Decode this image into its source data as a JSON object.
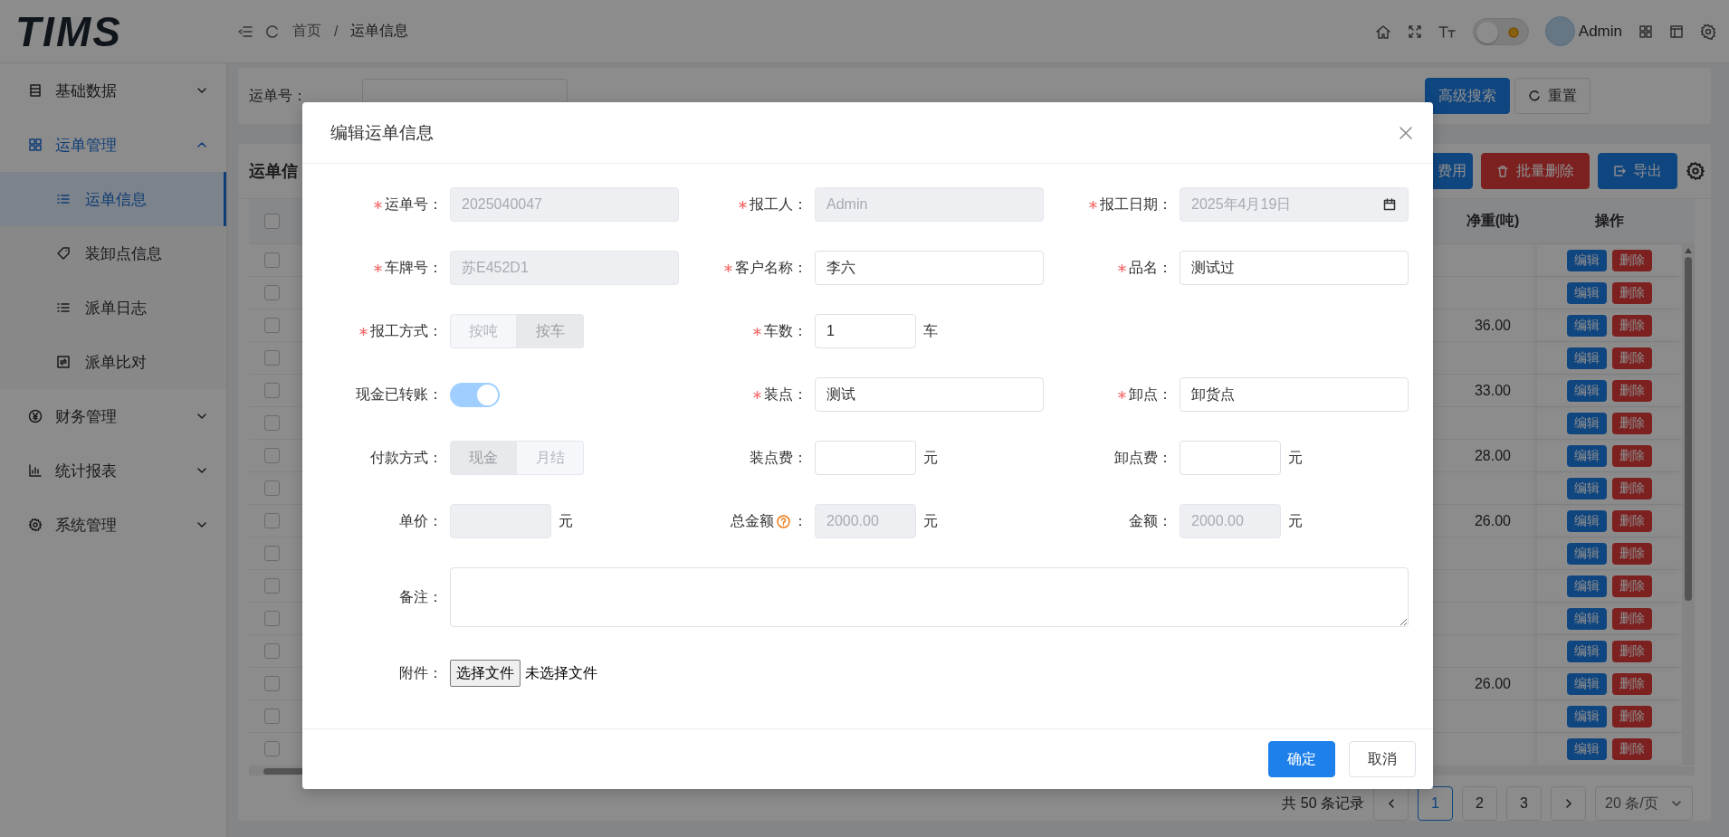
{
  "topbar": {
    "logo": "TIMS",
    "breadcrumb": [
      "首页",
      "运单信息"
    ],
    "separator": "/",
    "theme_switch": {
      "on": false
    },
    "user": "Admin"
  },
  "sidebar": {
    "items": [
      {
        "label": "基础数据",
        "expanded": false
      },
      {
        "label": "运单管理",
        "expanded": true,
        "children": [
          {
            "label": "运单信息",
            "selected": true
          },
          {
            "label": "装卸点信息",
            "selected": false
          },
          {
            "label": "派单日志",
            "selected": false
          },
          {
            "label": "派单比对",
            "selected": false
          }
        ]
      },
      {
        "label": "财务管理",
        "expanded": false
      },
      {
        "label": "统计报表",
        "expanded": false
      },
      {
        "label": "系统管理",
        "expanded": false
      }
    ]
  },
  "search_bar": {
    "label": "运单号：",
    "buttons": [
      {
        "label": "高级搜索",
        "kind": "primary"
      },
      {
        "label": "重置",
        "kind": "default"
      }
    ]
  },
  "table": {
    "title": "运单信",
    "toolbar_buttons": [
      {
        "label": "费用",
        "kind": "primary"
      },
      {
        "label": "批量删除",
        "kind": "danger"
      },
      {
        "label": "导出",
        "kind": "primary"
      }
    ],
    "select_all": false,
    "columns": [
      "净重(吨)",
      "操作"
    ],
    "rows": [
      {
        "selected": false,
        "actions": [
          "编辑",
          "删除"
        ]
      },
      {
        "selected": false,
        "actions": [
          "编辑",
          "删除"
        ]
      },
      {
        "selected": false,
        "net_weight": "36.00",
        "actions": [
          "编辑",
          "删除"
        ]
      },
      {
        "selected": false,
        "actions": [
          "编辑",
          "删除"
        ]
      },
      {
        "selected": false,
        "net_weight": "33.00",
        "actions": [
          "编辑",
          "删除"
        ]
      },
      {
        "selected": false,
        "actions": [
          "编辑",
          "删除"
        ]
      },
      {
        "selected": false,
        "net_weight": "28.00",
        "actions": [
          "编辑",
          "删除"
        ]
      },
      {
        "selected": false,
        "actions": [
          "编辑",
          "删除"
        ]
      },
      {
        "selected": false,
        "net_weight": "26.00",
        "actions": [
          "编辑",
          "删除"
        ]
      },
      {
        "selected": false,
        "actions": [
          "编辑",
          "删除"
        ]
      },
      {
        "selected": false,
        "actions": [
          "编辑",
          "删除"
        ]
      },
      {
        "selected": false,
        "actions": [
          "编辑",
          "删除"
        ]
      },
      {
        "selected": false,
        "actions": [
          "编辑",
          "删除"
        ]
      },
      {
        "selected": false,
        "net_weight": "26.00",
        "actions": [
          "编辑",
          "删除"
        ]
      },
      {
        "selected": false,
        "actions": [
          "编辑",
          "删除"
        ]
      },
      {
        "selected": false,
        "actions": [
          "编辑",
          "删除"
        ]
      }
    ]
  },
  "pagination": {
    "total": "共 50 条记录",
    "pages": [
      {
        "label": "1",
        "selected": true
      },
      {
        "label": "2",
        "selected": false
      },
      {
        "label": "3",
        "selected": false
      }
    ],
    "page_size": "20 条/页"
  },
  "modal": {
    "title": "编辑运单信息",
    "rows": [
      [
        {
          "kind": "text",
          "label": "运单号：",
          "required": true,
          "disabled": true,
          "value": "2025040047"
        },
        {
          "kind": "text",
          "label": "报工人：",
          "required": true,
          "disabled": true,
          "value": "Admin"
        },
        {
          "kind": "date",
          "label": "报工日期：",
          "required": true,
          "disabled": true,
          "value": "2025年4月19日"
        }
      ],
      [
        {
          "kind": "text",
          "label": "车牌号：",
          "required": true,
          "disabled": true,
          "value": "苏E452D1"
        },
        {
          "kind": "text",
          "label": "客户名称：",
          "required": true,
          "disabled": false,
          "value": "李六"
        },
        {
          "kind": "text",
          "label": "品名：",
          "required": true,
          "disabled": false,
          "value": "测试过"
        }
      ],
      [
        {
          "kind": "segmented",
          "label": "报工方式：",
          "required": true,
          "disabled": true,
          "options": [
            {
              "label": "按吨",
              "selected": false
            },
            {
              "label": "按车",
              "selected": true
            }
          ]
        },
        {
          "kind": "text",
          "label": "车数：",
          "required": true,
          "disabled": false,
          "value": "1",
          "unit": "车"
        }
      ],
      [
        {
          "kind": "switch",
          "label": "现金已转账：",
          "required": false,
          "disabled": true,
          "on": true
        },
        {
          "kind": "text",
          "label": "装点：",
          "required": true,
          "disabled": false,
          "value": "测试"
        },
        {
          "kind": "text",
          "label": "卸点：",
          "required": true,
          "disabled": false,
          "value": "卸货点"
        }
      ],
      [
        {
          "kind": "segmented",
          "label": "付款方式：",
          "required": false,
          "disabled": true,
          "options": [
            {
              "label": "现金",
              "selected": true
            },
            {
              "label": "月结",
              "selected": false
            }
          ]
        },
        {
          "kind": "text",
          "label": "装点费：",
          "required": false,
          "disabled": false,
          "unit": "元"
        },
        {
          "kind": "text",
          "label": "卸点费：",
          "required": false,
          "disabled": false,
          "unit": "元"
        }
      ],
      [
        {
          "kind": "text",
          "label": "单价：",
          "required": false,
          "disabled": true,
          "unit": "元"
        },
        {
          "kind": "text",
          "label": "总金额",
          "help": true,
          "label_tail": "：",
          "required": false,
          "disabled": true,
          "value": "2000.00",
          "unit": "元"
        },
        {
          "kind": "text",
          "label": "金额：",
          "required": false,
          "disabled": true,
          "value": "2000.00",
          "unit": "元"
        }
      ],
      [
        {
          "kind": "textarea",
          "label": "备注：",
          "required": false,
          "disabled": false
        }
      ],
      [
        {
          "kind": "file",
          "label": "附件：",
          "required": false,
          "button": "选择文件",
          "value": "未选择文件"
        }
      ]
    ],
    "buttons": [
      {
        "label": "确定",
        "kind": "primary"
      },
      {
        "label": "取消",
        "kind": "default"
      }
    ]
  }
}
